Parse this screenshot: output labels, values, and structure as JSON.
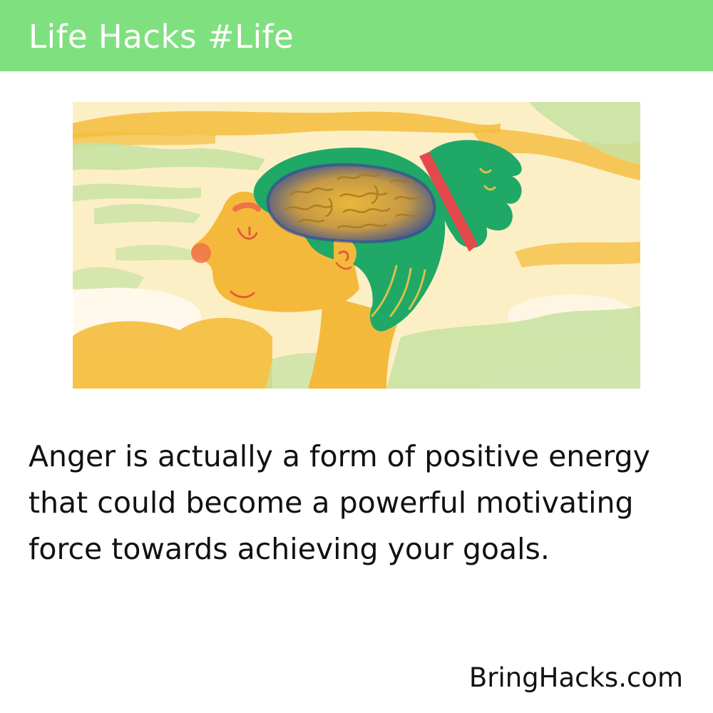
{
  "header": {
    "title": "Life Hacks #Life",
    "background_color": "#7fe07f"
  },
  "illustration": {
    "subject": "head-with-brain-icon",
    "colors": {
      "sky": "#fbeec4",
      "cloud_yellow": "#f4bd3c",
      "cloud_green": "#c7e2a1",
      "face": "#f4b93a",
      "hair": "#20a866",
      "brain": "#d3a840",
      "brain_outline": "#2d4a9a",
      "hair_band": "#e5484d"
    }
  },
  "body": {
    "text": "Anger is actually a form of positive energy that could become a powerful motivating force towards achieving your goals."
  },
  "footer": {
    "brand": "BringHacks.com"
  }
}
